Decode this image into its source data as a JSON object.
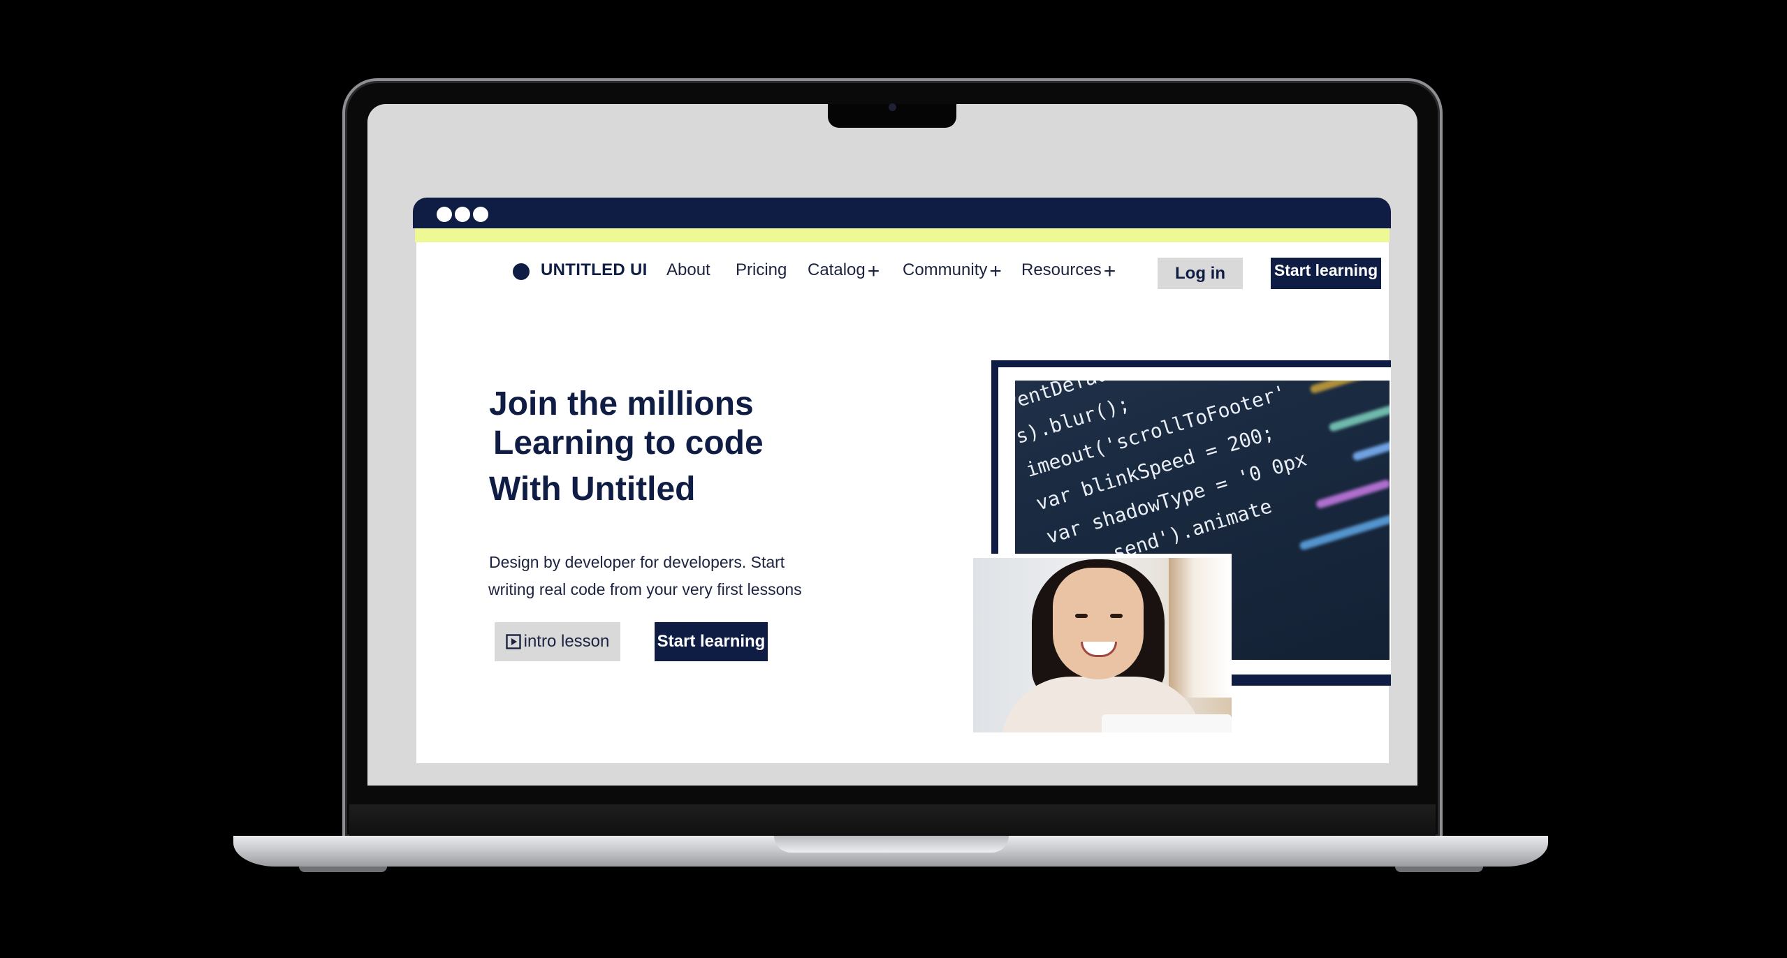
{
  "nav": {
    "brand": "UNTITLED UI",
    "links": [
      "About",
      "Pricing",
      "Catalog",
      "Community",
      "Resources"
    ],
    "expand_symbol": "+",
    "login_label": "Log in",
    "start_label": "Start learning"
  },
  "hero": {
    "title_lines": [
      "Join the millions",
      "Learning to code",
      "With Untitled"
    ],
    "description_lines": [
      "Design by developer for developers. Start",
      "writing real code from your very first lessons"
    ],
    "intro_label": "intro lesson",
    "start_label": "Start learning"
  },
  "code_image": {
    "lines": [
      "ventDefault()",
      "s).blur();",
      "imeout('scrollToFooter'",
      "var blinkSpeed = 200;",
      "var shadowType = '0 0px",
      "form send').animate"
    ]
  },
  "colors": {
    "navy": "#0f1c44",
    "accent": "#eef996",
    "screen_bg": "#d9d9d9",
    "button_gray": "#d9d9d9"
  }
}
